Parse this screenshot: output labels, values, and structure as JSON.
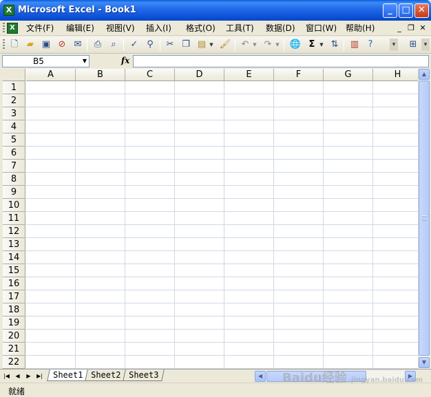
{
  "window": {
    "title": "Microsoft Excel - Book1",
    "app_icon": "excel-icon",
    "buttons": {
      "minimize": "_",
      "maximize": "□",
      "close": "✕"
    }
  },
  "menu": {
    "items": [
      {
        "label": "文件(F)"
      },
      {
        "label": "编辑(E)"
      },
      {
        "label": "视图(V)"
      },
      {
        "label": "插入(I)"
      },
      {
        "label": "格式(O)"
      },
      {
        "label": "工具(T)"
      },
      {
        "label": "数据(D)"
      },
      {
        "label": "窗口(W)"
      },
      {
        "label": "帮助(H)"
      }
    ],
    "mdi": {
      "minimize": "_",
      "restore": "❐",
      "close": "✕"
    }
  },
  "toolbar": {
    "icons": [
      "new-icon",
      "open-icon",
      "save-icon",
      "permission-icon",
      "email-icon",
      "print-icon",
      "print-preview-icon",
      "spelling-icon",
      "research-icon",
      "cut-icon",
      "copy-icon",
      "paste-icon",
      "format-painter-icon",
      "undo-icon",
      "redo-icon",
      "hyperlink-icon",
      "autosum-icon",
      "sort-ascending-icon",
      "chart-wizard-icon",
      "help-icon"
    ],
    "autosum_symbol": "Σ"
  },
  "formula_bar": {
    "name_box": "B5",
    "fx_label": "fx",
    "formula": ""
  },
  "grid": {
    "columns": [
      "A",
      "B",
      "C",
      "D",
      "E",
      "F",
      "G",
      "H"
    ],
    "rows": [
      "1",
      "2",
      "3",
      "4",
      "5",
      "6",
      "7",
      "8",
      "9",
      "10",
      "11",
      "12",
      "13",
      "14",
      "15",
      "16",
      "17",
      "18",
      "19",
      "20",
      "21",
      "22"
    ]
  },
  "sheets": {
    "tabs": [
      "Sheet1",
      "Sheet2",
      "Sheet3"
    ],
    "active": "Sheet1"
  },
  "status": {
    "text": "就绪"
  },
  "watermark": {
    "text": "Baidu经验",
    "sub": "jingyan.baidu.com"
  }
}
